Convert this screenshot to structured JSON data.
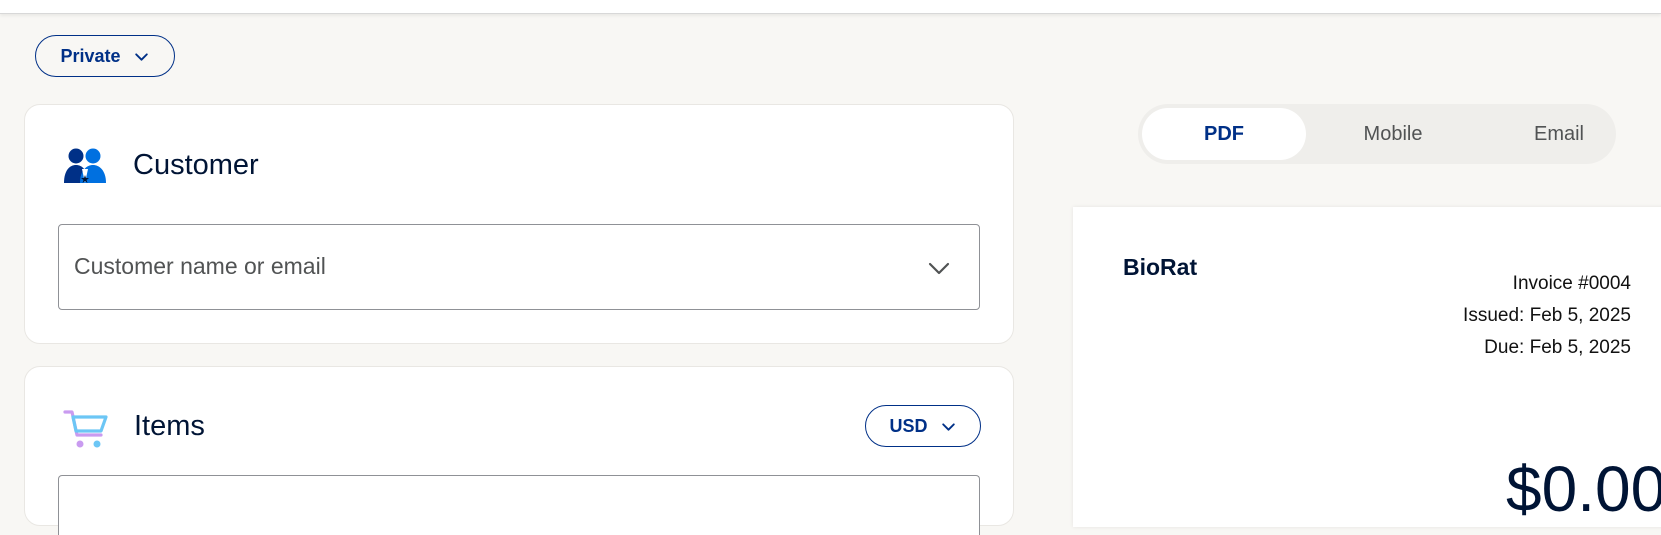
{
  "header": {
    "privacy_label": "Private"
  },
  "customer": {
    "title": "Customer",
    "placeholder": "Customer name or email"
  },
  "items": {
    "title": "Items",
    "currency": "USD"
  },
  "preview_tabs": [
    {
      "label": "PDF",
      "active": true
    },
    {
      "label": "Mobile",
      "active": false
    },
    {
      "label": "Email",
      "active": false
    }
  ],
  "invoice_preview": {
    "business_name": "BioRat",
    "invoice_number": "Invoice #0004",
    "issued": "Issued: Feb 5, 2025",
    "due": "Due: Feb 5, 2025",
    "total": "$0.00"
  },
  "colors": {
    "brand": "#003087",
    "accent": "#0070e0",
    "text": "#001435",
    "background": "#f8f7f4"
  },
  "icons": {
    "customer": "customers-icon",
    "items": "shopping-cart-icon",
    "dropdown": "chevron-down-icon"
  }
}
